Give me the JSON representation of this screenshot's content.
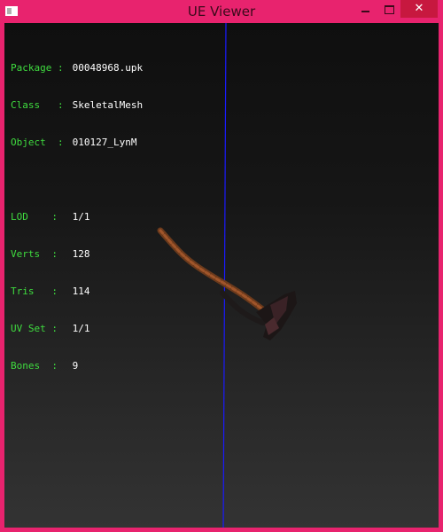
{
  "window": {
    "title": "UE Viewer",
    "controls": {
      "minimize": "minimize",
      "maximize": "maximize",
      "close": "✕"
    }
  },
  "info": {
    "object_rows": [
      {
        "key": "Package",
        "sep": ":",
        "value": "00048968.upk"
      },
      {
        "key": "Class",
        "sep": ":",
        "value": "SkeletalMesh"
      },
      {
        "key": "Object",
        "sep": ":",
        "value": "010127_LynM"
      }
    ],
    "mesh_rows": [
      {
        "key": "LOD",
        "sep": ":",
        "value": "1/1"
      },
      {
        "key": "Verts",
        "sep": ":",
        "value": "128"
      },
      {
        "key": "Tris",
        "sep": ":",
        "value": "114"
      },
      {
        "key": "UV Set",
        "sep": ":",
        "value": "1/1"
      },
      {
        "key": "Bones",
        "sep": ":",
        "value": "9"
      }
    ]
  },
  "colors": {
    "frame": "#e8236e",
    "label": "#3fdc3f",
    "value": "#ffffff",
    "axis": "#1a1aff",
    "close_button": "#c7183f"
  },
  "icons": {
    "app": "ue-viewer-app-icon",
    "minimize": "minimize-icon",
    "maximize": "maximize-icon",
    "close": "close-icon"
  }
}
